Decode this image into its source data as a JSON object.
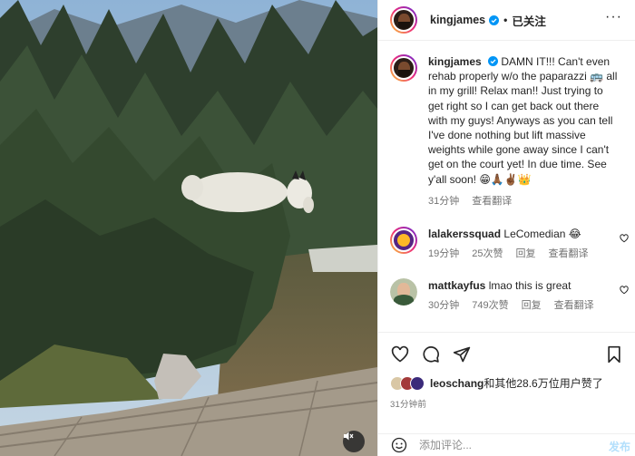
{
  "header": {
    "username": "kingjames",
    "follow_state": "已关注",
    "separator": "•"
  },
  "caption": {
    "username": "kingjames",
    "text": "DAMN IT!!! Can't even rehab properly w/o the paparazzi 🚌 all in my grill! Relax man!! Just trying to get right so I can get back out there with my guys! Anyways as you can tell I've done nothing but lift massive weights while gone away since I can't get on the court yet! In due time. See y'all soon! 😁🙏🏾✌🏾👑",
    "time": "31分钟",
    "translate": "查看翻译"
  },
  "comments": [
    {
      "username": "lalakerssquad",
      "text": "LeComedian 😂",
      "time": "19分钟",
      "likes": "25次赞",
      "reply": "回复",
      "translate": "查看翻译"
    },
    {
      "username": "mattkayfus",
      "text": "lmao this is great",
      "time": "30分钟",
      "likes": "749次赞",
      "reply": "回复",
      "translate": "查看翻译"
    }
  ],
  "likes": {
    "first_user": "leoschang",
    "rest": "和其他28.6万位用户赞了"
  },
  "time_ago": "31分钟前",
  "add_comment": {
    "placeholder": "添加评论...",
    "post_label": "发布"
  },
  "icons": {
    "verified": "verified-badge-icon",
    "more": "more-options-icon",
    "like": "heart-icon",
    "comment": "comment-icon",
    "share": "paper-plane-icon",
    "save": "bookmark-icon",
    "emoji": "emoji-icon",
    "mute": "speaker-muted-icon"
  },
  "colors": {
    "verified_blue": "#0095f6",
    "text": "#262626",
    "secondary": "#737373",
    "post_disabled": "#b2dffc"
  }
}
